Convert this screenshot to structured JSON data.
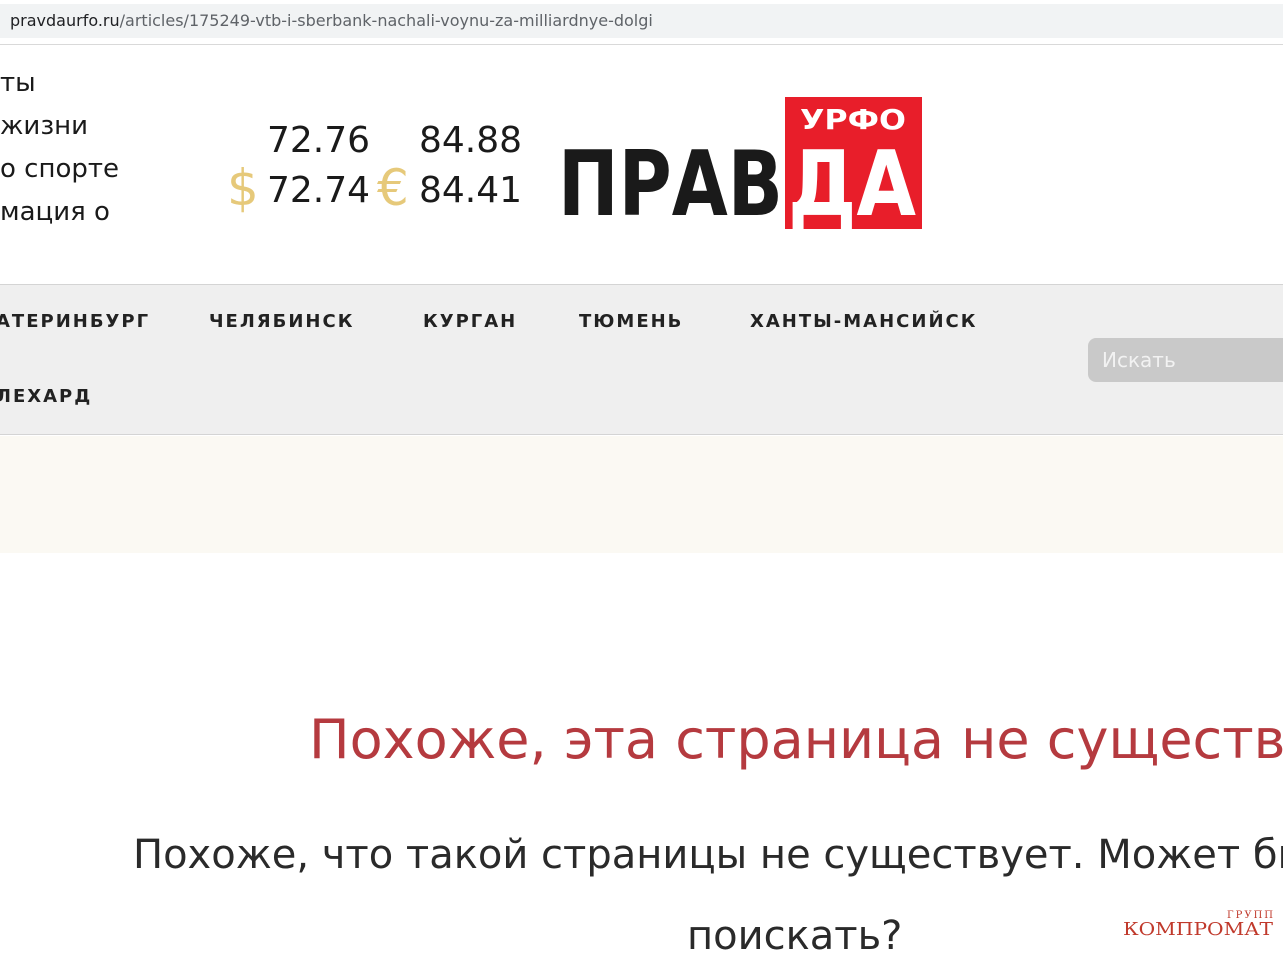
{
  "browser": {
    "url_domain": "pravdaurfo.ru",
    "url_path": "/articles/175249-vtb-i-sberbank-nachali-voynu-za-milliardnye-dolgi"
  },
  "header": {
    "links": [
      "ты",
      "жизни",
      "о спорте",
      "мация о"
    ],
    "currency": {
      "usd_symbol": "$",
      "eur_symbol": "€",
      "usd_values": [
        "72.76",
        "72.74"
      ],
      "eur_values": [
        "84.88",
        "84.41"
      ],
      "symbol_color": "#e6c97a"
    },
    "logo": {
      "main": "ПРАВ",
      "accent": "ДА",
      "tag": "УРФО",
      "accent_color": "#e81e2a"
    }
  },
  "nav": {
    "items": [
      "АТЕРИНБУРГ",
      "ЧЕЛЯБИНСК",
      "КУРГАН",
      "ТЮМЕНЬ",
      "ХАНТЫ-МАНСИЙСК",
      "ЛЕХАРД"
    ],
    "search_placeholder": "Искать"
  },
  "error": {
    "title": "Похоже, эта страница не существует.",
    "text_line1": "Похоже, что такой страницы не существует. Может быть поп",
    "text_line2": "поискать?",
    "title_color": "#b53a3f"
  },
  "watermark": {
    "top": "ГРУПП",
    "main": "КОМПРОМАТ"
  }
}
